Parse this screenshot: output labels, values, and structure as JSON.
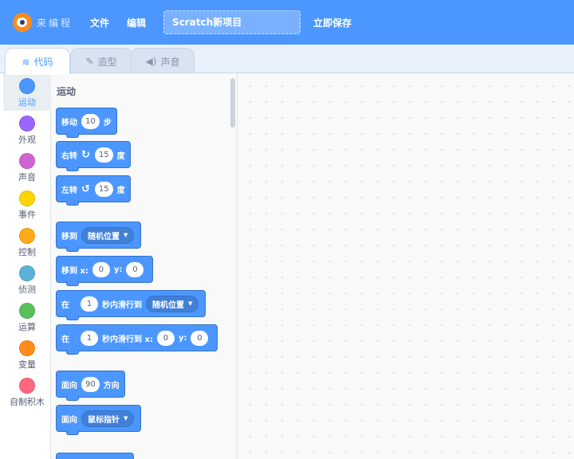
{
  "menubar": {
    "logo_text": "来编程",
    "file": "文件",
    "edit": "编辑",
    "project_title": "Scratch新项目",
    "save_now": "立即保存"
  },
  "tabs": [
    {
      "label": "代码",
      "icon": "code-icon",
      "glyph": "≋"
    },
    {
      "label": "造型",
      "icon": "brush-icon",
      "glyph": "✎"
    },
    {
      "label": "声音",
      "icon": "speaker-icon",
      "glyph": "◀)"
    }
  ],
  "categories": [
    {
      "label": "运动",
      "color": "#4c97ff"
    },
    {
      "label": "外观",
      "color": "#9966ff"
    },
    {
      "label": "声音",
      "color": "#cf63cf"
    },
    {
      "label": "事件",
      "color": "#ffd500"
    },
    {
      "label": "控制",
      "color": "#ffab19"
    },
    {
      "label": "侦测",
      "color": "#5cb1d6"
    },
    {
      "label": "运算",
      "color": "#59c059"
    },
    {
      "label": "变量",
      "color": "#ff8c1a"
    },
    {
      "label": "自制积木",
      "color": "#ff6680"
    }
  ],
  "palette": {
    "heading": "运动",
    "move": {
      "label": "移动",
      "steps": "10",
      "unit": "步"
    },
    "turn_right": {
      "label": "右转",
      "icon": "rotate-clockwise-icon",
      "glyph": "↻",
      "degrees": "15",
      "unit": "度"
    },
    "turn_left": {
      "label": "左转",
      "icon": "rotate-counterclockwise-icon",
      "glyph": "↺",
      "degrees": "15",
      "unit": "度"
    },
    "go_to": {
      "label": "移到",
      "target": "随机位置"
    },
    "go_to_xy": {
      "label": "移到 x:",
      "x": "0",
      "y_label": "y:",
      "y": "0"
    },
    "glide_to": {
      "prefix": "在",
      "secs": "1",
      "label": "秒内滑行到",
      "target": "随机位置"
    },
    "glide_xy": {
      "prefix": "在",
      "secs": "1",
      "label": "秒内滑行到 x:",
      "x": "0",
      "y_label": "y:",
      "y": "0"
    },
    "point_direction": {
      "label": "面向",
      "value": "90",
      "unit": "方向"
    },
    "point_towards": {
      "label": "面向",
      "target": "鼠标指针"
    }
  }
}
